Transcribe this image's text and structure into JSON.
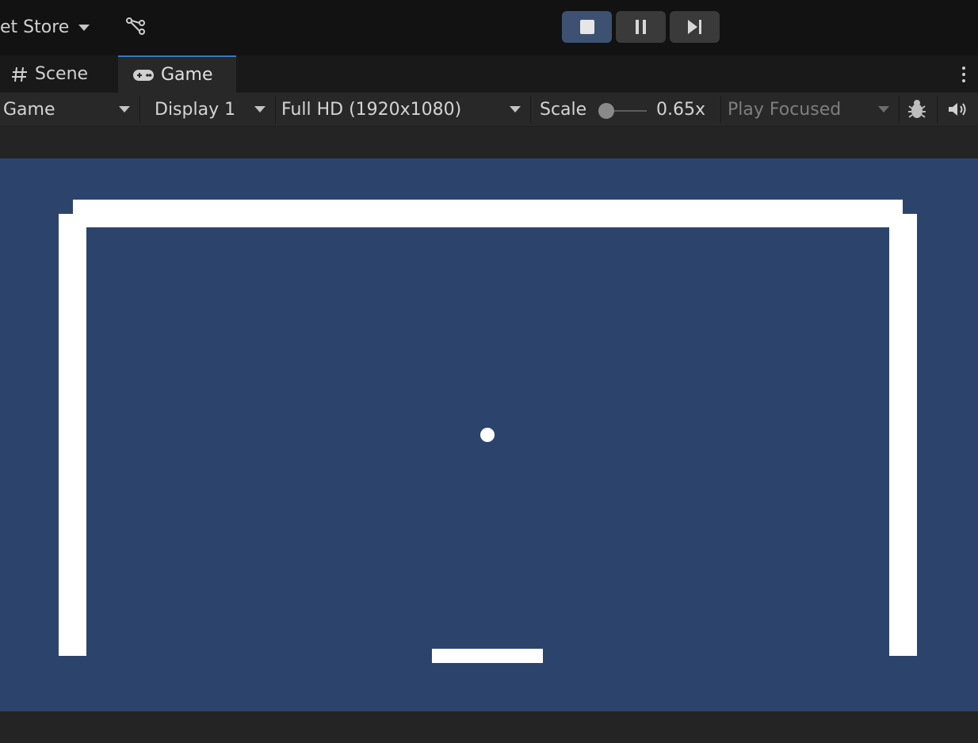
{
  "topbar": {
    "asset_store_label": "et Store",
    "graph_icon": "graph-nodes-icon",
    "play_controls": [
      {
        "name": "stop",
        "icon": "stop-icon",
        "active": true
      },
      {
        "name": "pause",
        "icon": "pause-icon",
        "active": false
      },
      {
        "name": "step",
        "icon": "step-icon",
        "active": false
      }
    ]
  },
  "tabs": [
    {
      "label": "Scene",
      "icon": "grid-hash-icon",
      "active": false
    },
    {
      "label": "Game",
      "icon": "gamepad-icon",
      "active": true
    }
  ],
  "toolbar": {
    "view_mode": "Game",
    "display": "Display 1",
    "resolution": "Full HD (1920x1080)",
    "scale_label": "Scale",
    "scale_value": "0.65x",
    "play_mode": "Play Focused",
    "debug_icon": "bug-icon",
    "audio_icon": "speaker-icon"
  },
  "game_view": {
    "background_color": "#2c446c",
    "object_color": "#ffffff",
    "objects": [
      "top-wall",
      "left-wall",
      "right-wall",
      "ball",
      "paddle"
    ]
  },
  "colors": {
    "accent": "#3a79bb",
    "active_control": "#3d5272",
    "topbar_bg": "#121212",
    "toolbar_bg": "#282828"
  }
}
